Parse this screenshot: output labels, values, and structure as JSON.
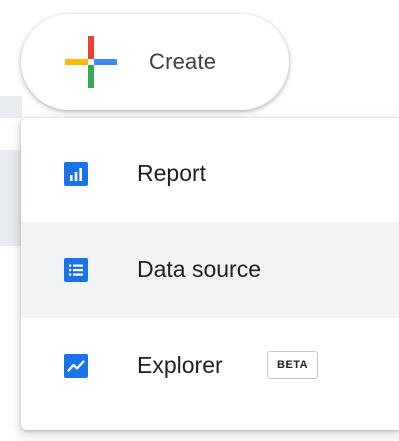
{
  "create_button": {
    "label": "Create",
    "icon": "google-plus-icon",
    "colors": {
      "red": "#EA4335",
      "blue": "#4285F4",
      "yellow": "#FBBC05",
      "green": "#34A853"
    }
  },
  "menu": {
    "items": [
      {
        "label": "Report",
        "icon": "bar-chart-icon",
        "badge": ""
      },
      {
        "label": "Data source",
        "icon": "list-icon",
        "badge": ""
      },
      {
        "label": "Explorer",
        "icon": "line-chart-icon",
        "badge": "BETA"
      }
    ],
    "icon_color": "#1A73E8",
    "hover_background": "#F1F3F4"
  }
}
